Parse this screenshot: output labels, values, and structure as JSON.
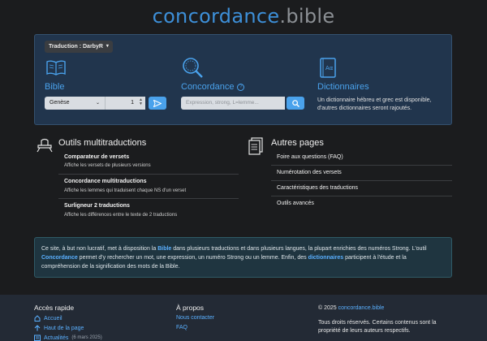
{
  "logo": {
    "part1": "concordance",
    "part2": ".bible"
  },
  "traduction": {
    "label": "Traduction : DarbyR",
    "caret": "▾"
  },
  "bible": {
    "title": "Bible",
    "book_value": "Genèse",
    "chapter_value": "1",
    "go_icon": "send-icon"
  },
  "concordance": {
    "title": "Concordance",
    "help_icon": "?",
    "placeholder": "Expression, strong, L=lemme..."
  },
  "dictionnaires": {
    "title": "Dictionnaires",
    "text": "Un dictionnaire hébreu et grec est disponible, d'autres dictionnaires seront rajoutés."
  },
  "outils": {
    "title": "Outils multitraductions",
    "items": [
      {
        "title": "Comparateur de versets",
        "sub": "Affiche les versets de plusieurs versions"
      },
      {
        "title": "Concordance multitraductions",
        "sub": "Affiche les lemmes qui traduisent chaque NS d'un verset"
      },
      {
        "title": "Surligneur 2 traductions",
        "sub": "Affiche les différences entre le texte de 2 traductions"
      }
    ]
  },
  "autres": {
    "title": "Autres pages",
    "items": [
      {
        "label": "Foire aux questions (FAQ)"
      },
      {
        "label": "Numérotation des versets"
      },
      {
        "label": "Caractéristiques des traductions"
      },
      {
        "label": "Outils avancés"
      }
    ]
  },
  "info": {
    "t1": "Ce site, à but non lucratif, met à disposition la ",
    "h1": "Bible",
    "t2": " dans plusieurs traductions et dans plusieurs langues, la plupart enrichies des numéros Strong.",
    "t3": "L'outil ",
    "h2": "Concordance",
    "t4": " permet d'y rechercher un mot, une expression, un numéro Strong ou un lemme. Enfin, des ",
    "h3": "dictionnaires",
    "t5": " participent à l'étude et la compréhension de la signification des mots de la Bible."
  },
  "footer": {
    "acces_title": "Accès rapide",
    "acces": [
      {
        "label": "Accueil",
        "icon": "home-icon"
      },
      {
        "label": "Haut de la page",
        "icon": "arrow-up-icon"
      },
      {
        "label": "Actualités",
        "date": "(6 mars 2025)",
        "icon": "news-icon"
      }
    ],
    "apropos_title": "À propos",
    "apropos": [
      {
        "label": "Nous contacter"
      },
      {
        "label": "FAQ"
      }
    ],
    "copyright_prefix": "© 2025 ",
    "copyright_site": "concordance.bible",
    "rights": "Tous droits réservés. Certains contenus sont la propriété de leurs auteurs respectifs."
  },
  "colors": {
    "accent": "#4aa2ec",
    "panel": "#21354d",
    "background": "#1b1c1e",
    "footer": "#232a35"
  }
}
